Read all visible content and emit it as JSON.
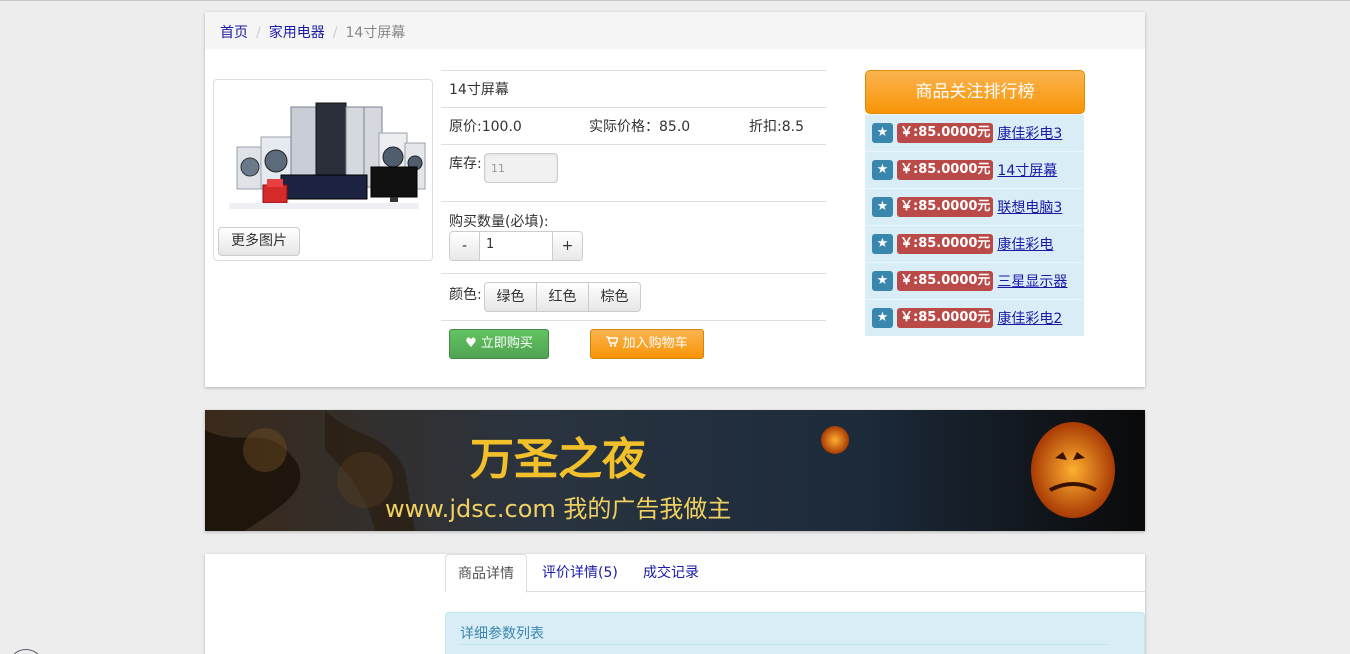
{
  "breadcrumb": {
    "home": "首页",
    "category": "家用电器",
    "current": "14寸屏幕"
  },
  "gallery": {
    "image_alt": "家用电器组合图",
    "more_button": "更多图片"
  },
  "product": {
    "name": "14寸屏幕",
    "original_price": "原价:100.0",
    "actual_price": "实际价格：85.0",
    "discount": "折扣:8.5",
    "stock_label": "库存:",
    "stock_value": "11",
    "quantity_label": "购买数量(必填):",
    "qty_minus": "-",
    "qty_value": "1",
    "qty_plus": "+",
    "color_label": "颜色:",
    "colors": [
      "绿色",
      "红色",
      "棕色"
    ],
    "buy_now": "立即购买",
    "add_to_cart": "加入购物车"
  },
  "ranking": {
    "title": "商品关注排行榜",
    "items": [
      {
        "price": "￥:85.0000元",
        "name": "康佳彩电3"
      },
      {
        "price": "￥:85.0000元",
        "name": "14寸屏幕"
      },
      {
        "price": "￥:85.0000元",
        "name": "联想电脑3"
      },
      {
        "price": "￥:85.0000元",
        "name": "康佳彩电"
      },
      {
        "price": "￥:85.0000元",
        "name": "三星显示器"
      },
      {
        "price": "￥:85.0000元",
        "name": "康佳彩电2"
      }
    ]
  },
  "ad_banner": {
    "headline": "万圣之夜",
    "slogan": "www.jdsc.com 我的广告我做主"
  },
  "detail_tabs": {
    "tabs": [
      "商品详情",
      "评价详情(5)",
      "成交记录"
    ],
    "param_title": "详细参数列表"
  },
  "colors": {
    "link": "#1a1aa6",
    "buy_green": "#51a351",
    "orange": "#f89406",
    "badge_blue": "#3a87ad",
    "badge_red": "#b94a48",
    "info_bg": "#d9edf7"
  }
}
